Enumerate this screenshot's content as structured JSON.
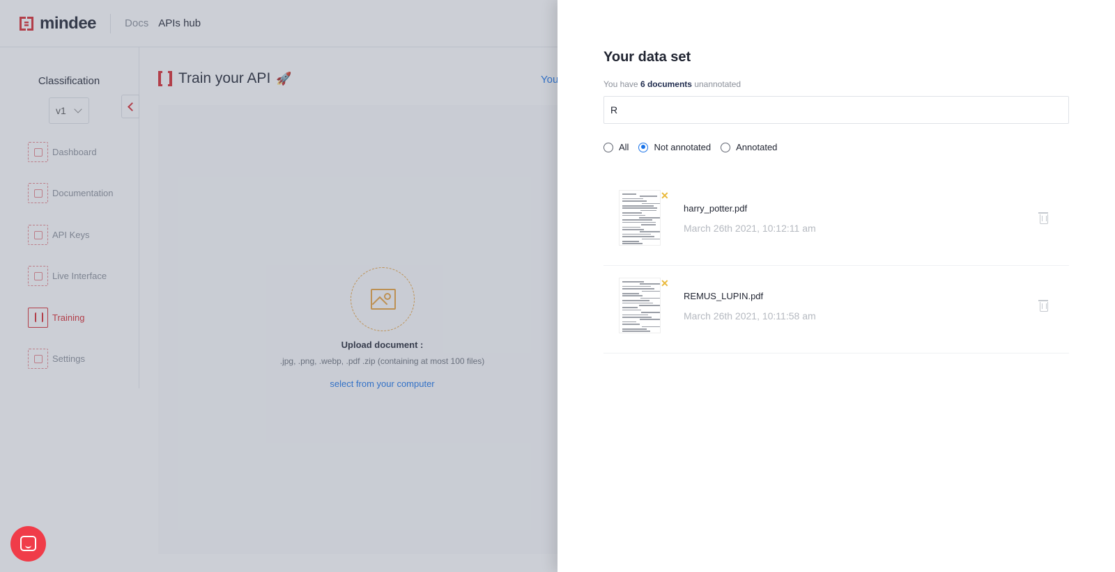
{
  "topbar": {
    "brand": "mindee",
    "links": [
      "Docs",
      "APIs hub"
    ]
  },
  "sidebar": {
    "title": "Classification",
    "version": "v1",
    "items": [
      {
        "label": "Dashboard",
        "icon": "dashboard-icon"
      },
      {
        "label": "Documentation",
        "icon": "documentation-icon"
      },
      {
        "label": "API Keys",
        "icon": "lock-icon"
      },
      {
        "label": "Live Interface",
        "icon": "live-interface-icon"
      },
      {
        "label": "Training",
        "icon": "upload-arrow-icon",
        "active": true
      },
      {
        "label": "Settings",
        "icon": "gear-icon"
      }
    ]
  },
  "main": {
    "title": "Train your API",
    "title_emoji": "🚀",
    "peek_link": "You",
    "upload": {
      "title": "Upload document :",
      "formats": ".jpg, .png, .webp, .pdf .zip (containing at most 100 files)",
      "select": "select from your computer"
    }
  },
  "drawer": {
    "title": "Your data set",
    "subtitle_prefix": "You have",
    "subtitle_count": "6 documents",
    "subtitle_suffix": "unannotated",
    "search_value": "R",
    "filters": [
      {
        "label": "All",
        "checked": false
      },
      {
        "label": "Not annotated",
        "checked": true
      },
      {
        "label": "Annotated",
        "checked": false
      }
    ],
    "documents": [
      {
        "name": "harry_potter.pdf",
        "date": "March 26th 2021, 10:12:11 am",
        "status": "not-annotated"
      },
      {
        "name": "REMUS_LUPIN.pdf",
        "date": "March 26th 2021, 10:11:58 am",
        "status": "not-annotated"
      }
    ]
  },
  "colors": {
    "brand_red": "#d9272e",
    "link_blue": "#1a73e8",
    "upload_orange": "#e9a23b",
    "chat_bubble": "#f03c49"
  }
}
